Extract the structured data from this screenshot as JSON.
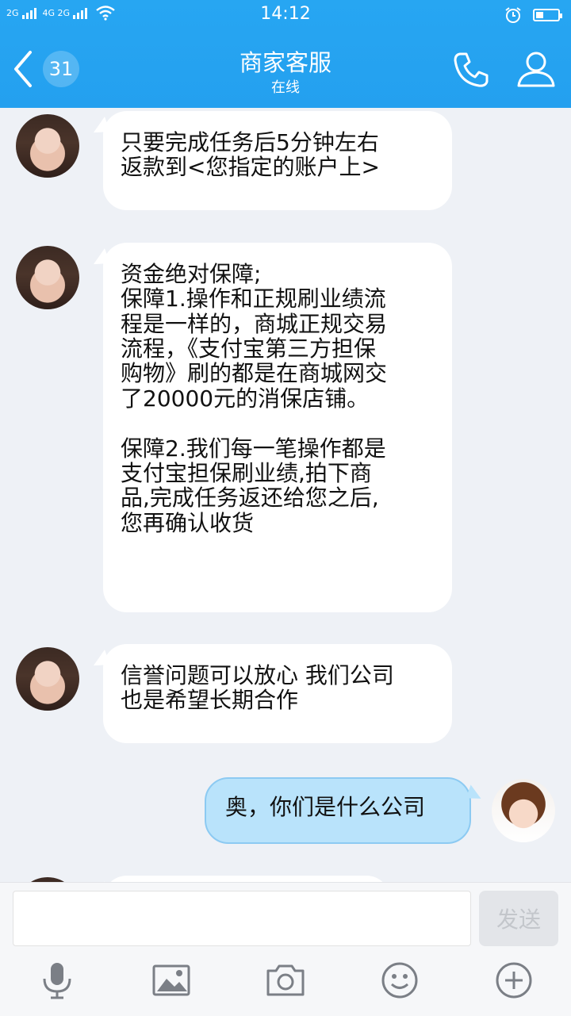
{
  "status_bar": {
    "network_label_1": "2G",
    "network_label_2": "4G 2G",
    "time": "14:12"
  },
  "header": {
    "badge_count": "31",
    "title": "商家客服",
    "subtitle": "在线",
    "icons": {
      "back": "chevron-left-icon",
      "call": "phone-icon",
      "profile": "person-icon"
    }
  },
  "messages": [
    {
      "from": "them",
      "text": "只要完成任务后5分钟左右\n返款到<您指定的账户上>"
    },
    {
      "from": "them",
      "text": "资金绝对保障;\n保障1.操作和正规刷业绩流\n程是一样的，商城正规交易\n流程，《支付宝第三方担保\n购物》刷的都是在商城网交\n了20000元的消保店铺。\n\n保障2.我们每一笔操作都是\n支付宝担保刷业绩,拍下商\n品,完成任务返还给您之后,\n您再确认收货"
    },
    {
      "from": "them",
      "text": "信誉问题可以放心 我们公司\n也是希望长期合作"
    },
    {
      "from": "me",
      "text": "奥，你们是什么公司"
    }
  ],
  "input": {
    "text_value": "",
    "send_label": "发送",
    "toolbar_icons": [
      "microphone-icon",
      "image-icon",
      "camera-icon",
      "emoji-icon",
      "plus-circle-icon"
    ]
  },
  "colors": {
    "header": "#24a0ef",
    "background": "#eef1f6",
    "outgoing_bubble": "#b9e3fb",
    "incoming_bubble": "#ffffff"
  }
}
